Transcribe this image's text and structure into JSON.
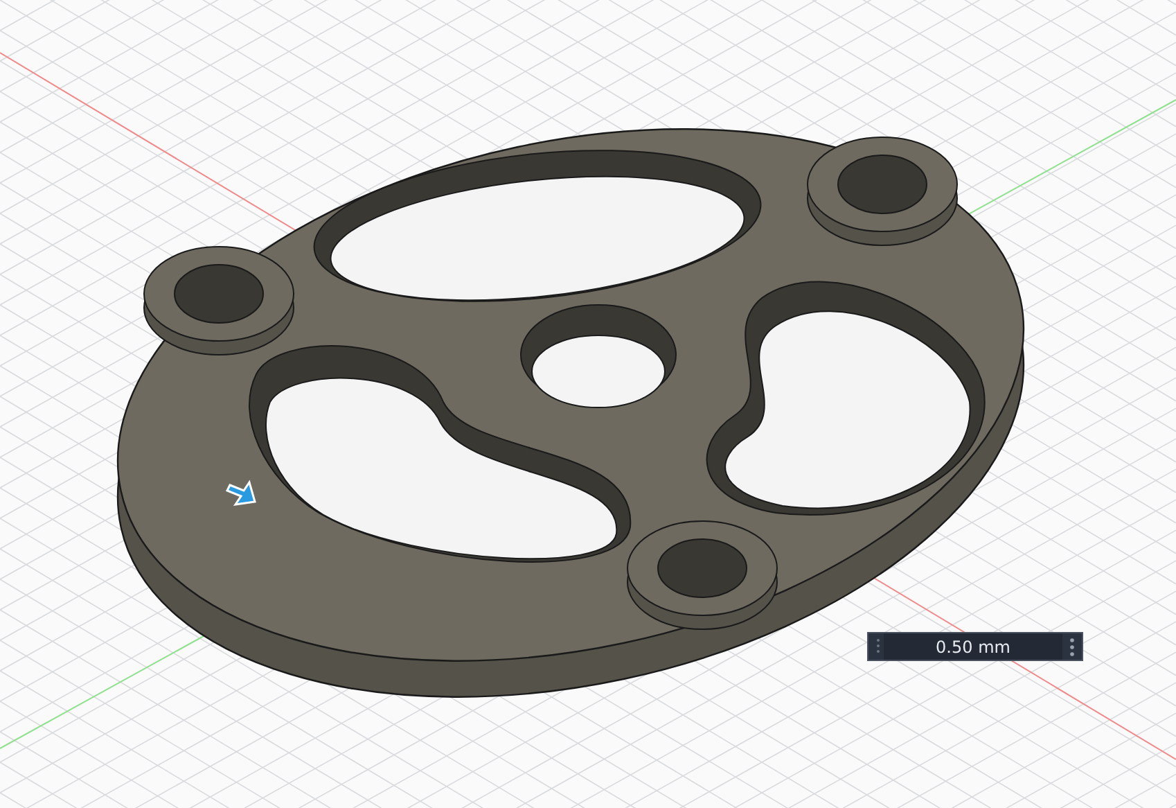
{
  "viewport": {
    "dimension_input": {
      "value": "0.50 mm"
    }
  }
}
